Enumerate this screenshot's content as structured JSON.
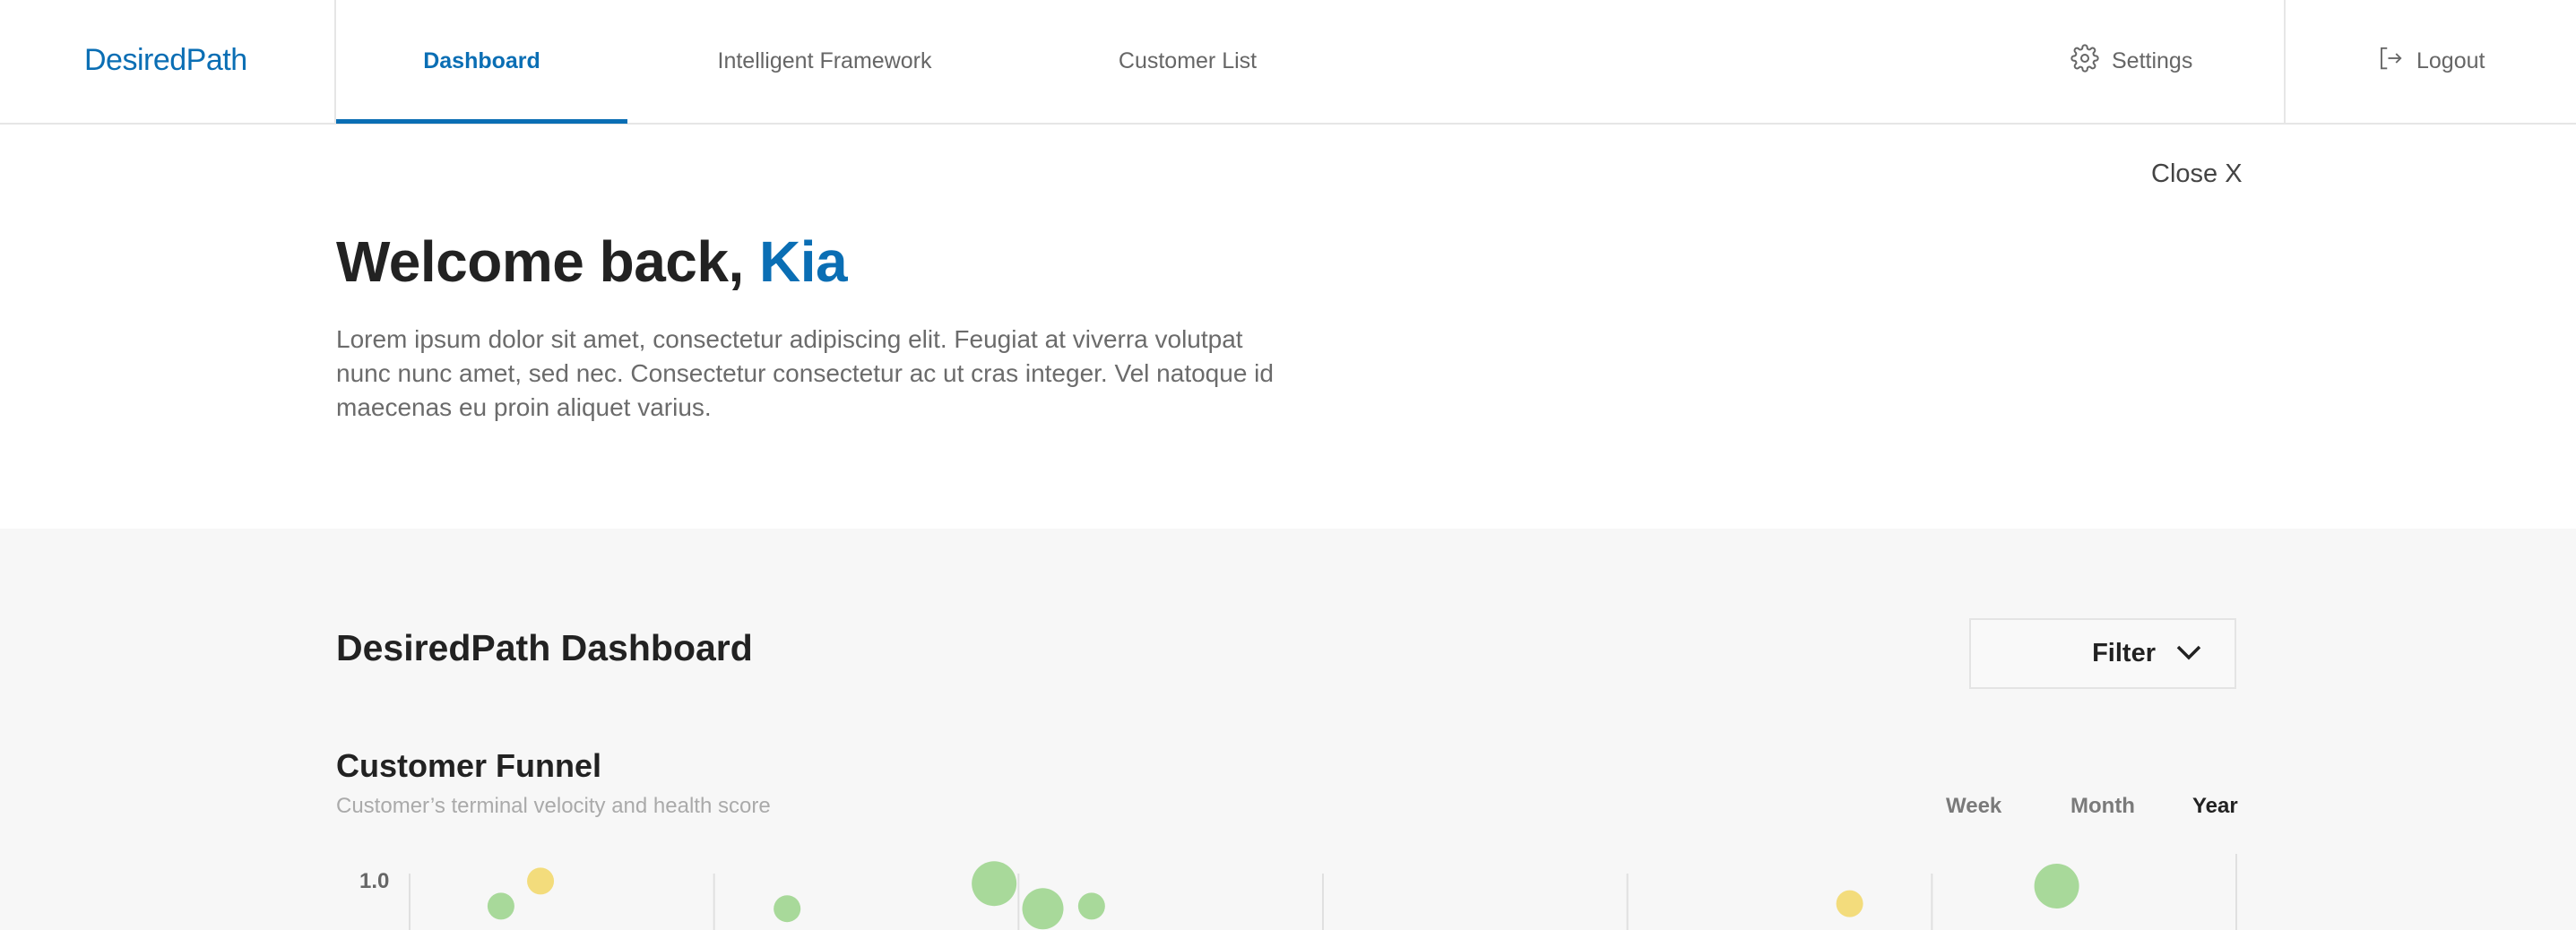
{
  "nav": {
    "logo": "DesiredPath",
    "tabs": [
      {
        "label": "Dashboard",
        "active": true
      },
      {
        "label": "Intelligent Framework",
        "active": false
      },
      {
        "label": "Customer List",
        "active": false
      }
    ],
    "settings_label": "Settings",
    "logout_label": "Logout"
  },
  "welcome": {
    "close_label": "Close X",
    "greeting": "Welcome back,",
    "name": "Kia",
    "intro": "Lorem ipsum dolor sit amet, consectetur adipiscing elit. Feugiat at viverra volutpat nunc nunc amet, sed nec. Consectetur consectetur ac ut cras integer. Vel natoque id maecenas eu proin aliquet varius."
  },
  "dashboard": {
    "title": "DesiredPath Dashboard",
    "filter_label": "Filter",
    "funnel": {
      "title": "Customer Funnel",
      "subtitle": "Customer’s terminal velocity and health score",
      "ranges": [
        "Week",
        "Month",
        "Year"
      ],
      "selected_range": "Year"
    }
  },
  "colors": {
    "brand": "#0a6eb4",
    "healthy": "#a8d99a",
    "warning": "#f3dc7c"
  },
  "chart_data": {
    "type": "scatter",
    "y_tick_labels": [
      "1.0"
    ],
    "columns": 6,
    "points": [
      {
        "column": 0,
        "x": 0.43,
        "y": 0.97,
        "status": "warning",
        "size": "small"
      },
      {
        "column": 0,
        "x": 0.3,
        "y": 0.87,
        "status": "healthy",
        "size": "small"
      },
      {
        "column": 1,
        "x": 0.24,
        "y": 0.86,
        "status": "healthy",
        "size": "small"
      },
      {
        "column": 1,
        "x": 0.92,
        "y": 0.96,
        "status": "healthy",
        "size": "large"
      },
      {
        "column": 2,
        "x": 0.08,
        "y": 0.86,
        "status": "healthy",
        "size": "medium"
      },
      {
        "column": 2,
        "x": 0.24,
        "y": 0.87,
        "status": "healthy",
        "size": "small"
      },
      {
        "column": 4,
        "x": 0.73,
        "y": 0.88,
        "status": "warning",
        "size": "small"
      },
      {
        "column": 5,
        "x": 0.41,
        "y": 0.95,
        "status": "healthy",
        "size": "large"
      }
    ]
  }
}
